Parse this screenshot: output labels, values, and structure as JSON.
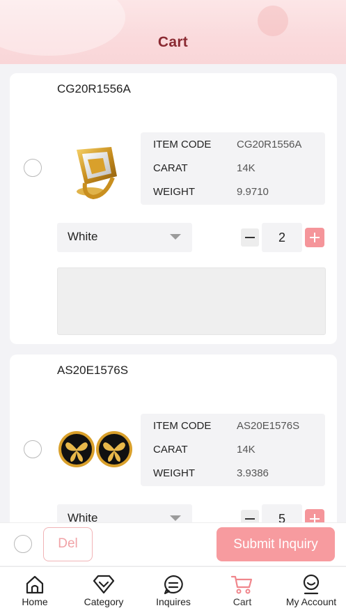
{
  "header": {
    "title": "Cart"
  },
  "items": [
    {
      "code": "CG20R1556A",
      "rows": [
        {
          "key": "ITEM CODE",
          "value": "CG20R1556A"
        },
        {
          "key": "CARAT",
          "value": "14K"
        },
        {
          "key": "WEIGHT",
          "value": "9.9710"
        }
      ],
      "color": "White",
      "quantity": "2",
      "image": "gold-ring-photo"
    },
    {
      "code": "AS20E1576S",
      "rows": [
        {
          "key": "ITEM CODE",
          "value": "AS20E1576S"
        },
        {
          "key": "CARAT",
          "value": "14K"
        },
        {
          "key": "WEIGHT",
          "value": "3.9386"
        }
      ],
      "color": "White",
      "quantity": "5",
      "image": "butterfly-earrings-photo"
    }
  ],
  "bottom_bar": {
    "delete_label": "Del",
    "submit_label": "Submit Inquiry"
  },
  "tabbar": {
    "tabs": [
      {
        "label": "Home",
        "icon": "home-icon"
      },
      {
        "label": "Category",
        "icon": "diamond-icon"
      },
      {
        "label": "Inquires",
        "icon": "chat-bubble-icon"
      },
      {
        "label": "Cart",
        "icon": "cart-icon"
      },
      {
        "label": "My Account",
        "icon": "user-icon"
      }
    ],
    "active": "Cart"
  },
  "colors": {
    "accent": "#f79b9f",
    "title": "#8a2a32",
    "header_bg": "#fadadc"
  }
}
